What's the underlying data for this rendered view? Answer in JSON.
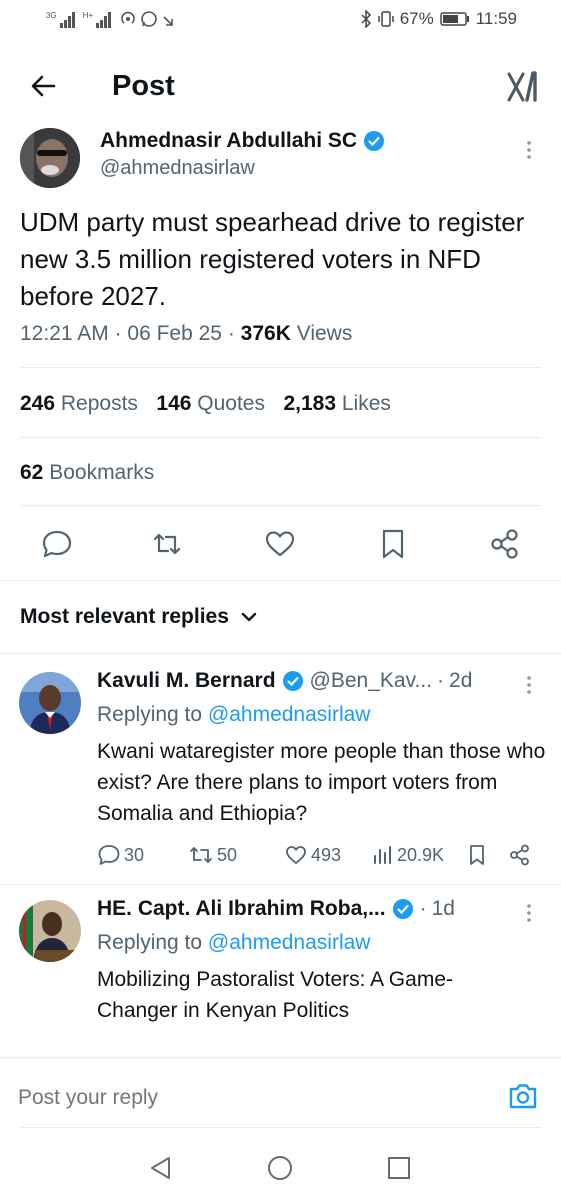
{
  "status_bar": {
    "network_left": "3G",
    "network_right": "H+",
    "battery": "67%",
    "time": "11:59"
  },
  "header": {
    "title": "Post",
    "logo_icon": "x-logo-icon"
  },
  "post": {
    "author_name": "Ahmednasir Abdullahi SC",
    "handle": "@ahmednasirlaw",
    "text": "UDM party must spearhead drive to register new 3.5 million registered voters in NFD before 2027.",
    "time": "12:21 AM",
    "date": "06 Feb 25",
    "views_count": "376K",
    "views_label": "Views",
    "stats": {
      "reposts_count": "246",
      "reposts_label": "Reposts",
      "quotes_count": "146",
      "quotes_label": "Quotes",
      "likes_count": "2,183",
      "likes_label": "Likes",
      "bookmarks_count": "62",
      "bookmarks_label": "Bookmarks"
    }
  },
  "replies_header": {
    "label": "Most relevant replies"
  },
  "replies": [
    {
      "name": "Kavuli M. Bernard",
      "handle": "@Ben_Kav...",
      "age": "2d",
      "replying_prefix": "Replying to",
      "replying_to": "@ahmednasirlaw",
      "text": "Kwani wataregister more people than those who exist? Are there plans to import voters from Somalia and Ethiopia?",
      "replies": "30",
      "reposts": "50",
      "likes": "493",
      "views": "20.9K"
    },
    {
      "name": "HE. Capt. Ali Ibrahim Roba,...",
      "handle": "",
      "age": "1d",
      "replying_prefix": "Replying to",
      "replying_to": "@ahmednasirlaw",
      "text": "Mobilizing Pastoralist Voters: A Game-Changer in Kenyan Politics"
    }
  ],
  "composer": {
    "placeholder": "Post your reply"
  },
  "colors": {
    "accent": "#1d9bf0",
    "text": "#0f1419",
    "muted": "#536471",
    "divider": "#e6ecf0"
  }
}
